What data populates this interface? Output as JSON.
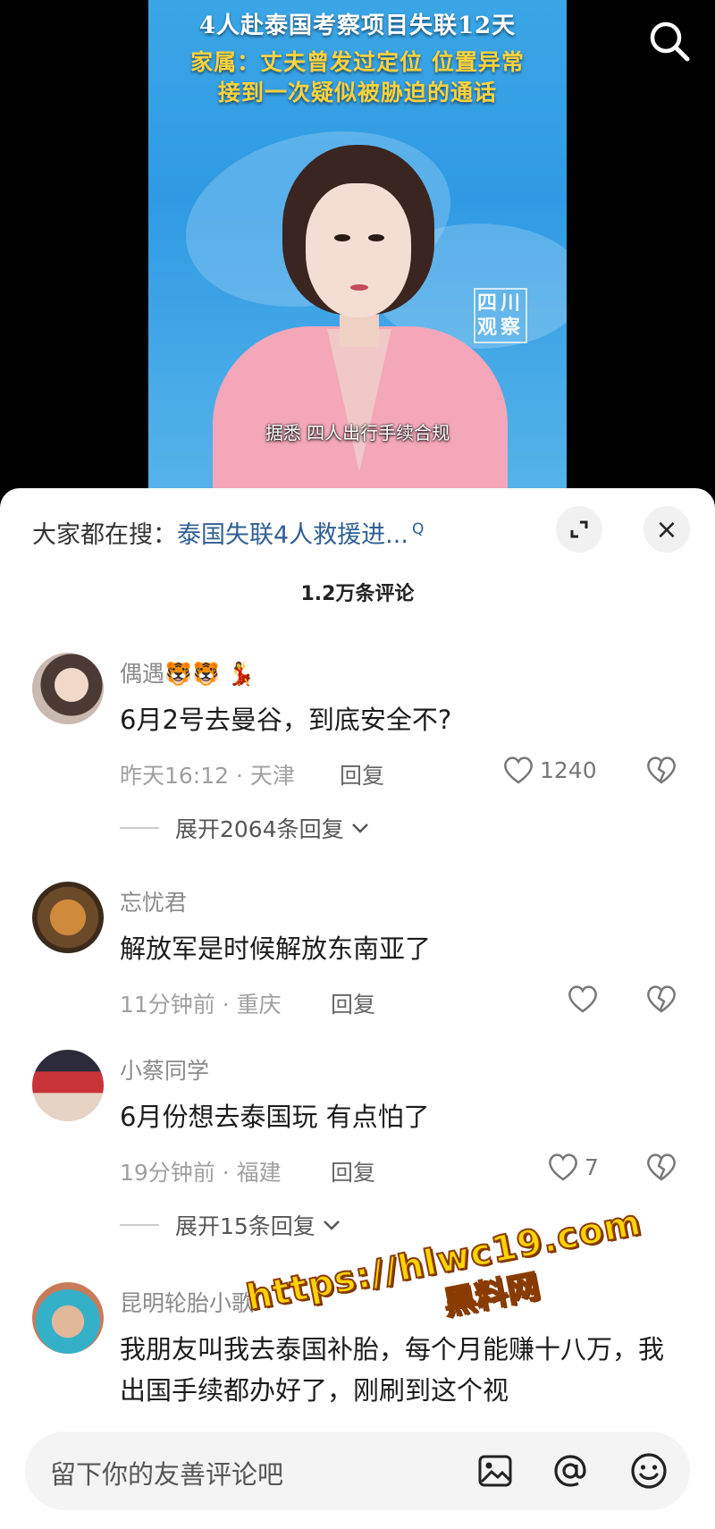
{
  "video": {
    "headline_1": "4人赴泰国考察项目失联12天",
    "headline_2": "家属：丈夫曾发过定位 位置异常",
    "headline_3": "接到一次疑似被胁迫的通话",
    "watermark": "四川观察",
    "subtitle": "据悉 四人出行手续合规",
    "search_icon": "search-icon"
  },
  "sheet": {
    "hot_search_label": "大家都在搜：",
    "hot_search_link": "泰国失联4人救援进...",
    "hot_search_mark": "Q",
    "expand_icon": "expand-icon",
    "close_icon": "close-icon",
    "close_label": "×",
    "comment_count": "1.2万条评论"
  },
  "comments": [
    {
      "nickname": "偶遇🐯🐯 💃",
      "text": "6月2号去曼谷，到底安全不?",
      "meta": "昨天16:12 · 天津",
      "reply": "回复",
      "likes": "1240",
      "expand": "展开2064条回复"
    },
    {
      "nickname": "忘忧君",
      "text": "解放军是时候解放东南亚了",
      "meta": "11分钟前 · 重庆",
      "reply": "回复",
      "likes": ""
    },
    {
      "nickname": "小蔡同学",
      "text": "6月份想去泰国玩 有点怕了",
      "meta": "19分钟前 · 福建",
      "reply": "回复",
      "likes": "7",
      "expand": "展开15条回复"
    },
    {
      "nickname": "昆明轮胎小歌",
      "text": "我朋友叫我去泰国补胎，每个月能赚十八万，我出国手续都办好了，刚刷到这个视"
    }
  ],
  "input_bar": {
    "placeholder": "留下你的友善评论吧",
    "icons": [
      "image-icon",
      "at-icon",
      "emoji-icon"
    ]
  },
  "overlay": {
    "url": "https://hlwc19.com",
    "name": "黑料网"
  },
  "colors": {
    "link": "#2f5e93",
    "promo_yellow": "#ffd400",
    "news_yellow": "#ffd23c"
  }
}
